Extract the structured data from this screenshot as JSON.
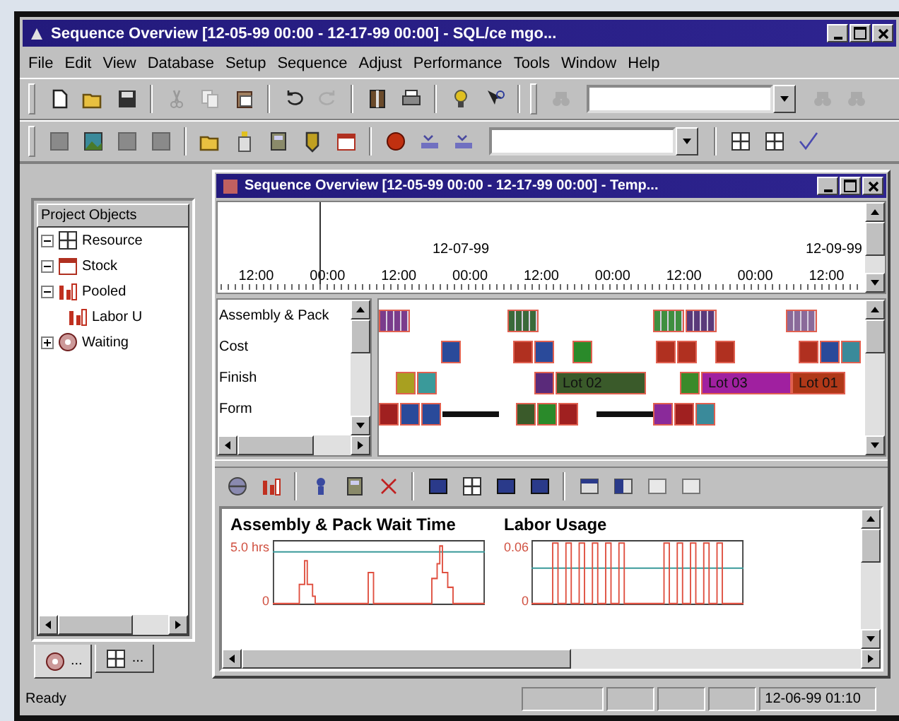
{
  "window": {
    "title": "Sequence Overview [12-05-99 00:00 - 12-17-99 00:00] - SQL/ce mgo..."
  },
  "menu": [
    "File",
    "Edit",
    "View",
    "Database",
    "Setup",
    "Sequence",
    "Adjust",
    "Performance",
    "Tools",
    "Window",
    "Help"
  ],
  "project_panel": {
    "title": "Project Objects",
    "tree": [
      {
        "label": "Resource",
        "expanded": true
      },
      {
        "label": "Stock",
        "expanded": true
      },
      {
        "label": "Pooled",
        "expanded": true,
        "children": [
          {
            "label": "Labor U"
          }
        ]
      },
      {
        "label": "Waiting",
        "expanded": false
      }
    ],
    "tabs": [
      {
        "label": "...",
        "selected": true
      },
      {
        "label": "...",
        "selected": false
      }
    ]
  },
  "sequence_window": {
    "title": "Sequence Overview [12-05-99 00:00 - 12-17-99 00:00] - Temp...",
    "timeline": {
      "dates": [
        "12-07-99",
        "12-09-99"
      ],
      "times": [
        "12:00",
        "00:00",
        "12:00",
        "00:00",
        "12:00",
        "00:00",
        "12:00",
        "00:00",
        "12:00"
      ]
    },
    "gantt": {
      "rows": [
        {
          "label": "Assembly & Pack",
          "segments": [
            {
              "kind": "stack",
              "color": "#7a3c8c"
            },
            {
              "kind": "space"
            },
            {
              "kind": "gap"
            },
            {
              "kind": "gap"
            },
            {
              "kind": "stack",
              "color": "#3a6a3a"
            },
            {
              "kind": "space"
            },
            {
              "kind": "gap"
            },
            {
              "kind": "gap"
            },
            {
              "kind": "gap"
            },
            {
              "kind": "stack",
              "color": "#3f8f3f"
            },
            {
              "kind": "stack",
              "color": "#5a3a7a"
            },
            {
              "kind": "gap"
            },
            {
              "kind": "gap"
            },
            {
              "kind": "gap"
            },
            {
              "kind": "gap"
            },
            {
              "kind": "stack",
              "color": "#8a6a9a"
            }
          ]
        },
        {
          "label": "Cost",
          "segments": [
            {
              "kind": "space"
            },
            {
              "kind": "block",
              "color": "#2a4a9a"
            },
            {
              "kind": "gap"
            },
            {
              "kind": "gap"
            },
            {
              "kind": "gap"
            },
            {
              "kind": "block",
              "color": "#b03020"
            },
            {
              "kind": "block",
              "color": "#2a4a9a"
            },
            {
              "kind": "gap"
            },
            {
              "kind": "block",
              "color": "#2a8a2a"
            },
            {
              "kind": "space"
            },
            {
              "kind": "block",
              "color": "#b03020"
            },
            {
              "kind": "block",
              "color": "#b03020"
            },
            {
              "kind": "gap"
            },
            {
              "kind": "block",
              "color": "#b03020"
            },
            {
              "kind": "space"
            },
            {
              "kind": "block",
              "color": "#b03020"
            },
            {
              "kind": "block",
              "color": "#2a4a9a"
            },
            {
              "kind": "block",
              "color": "#3a8a9a"
            }
          ]
        },
        {
          "label": "Finish",
          "segments": [
            {
              "kind": "gap"
            },
            {
              "kind": "block",
              "color": "#a8a020"
            },
            {
              "kind": "block",
              "color": "#3a9a9a"
            },
            {
              "kind": "space"
            },
            {
              "kind": "gap"
            },
            {
              "kind": "gap"
            },
            {
              "kind": "block",
              "color": "#5a2a7a"
            },
            {
              "kind": "lot",
              "color": "#3a5a2a",
              "label": "Lot 02"
            },
            {
              "kind": "gap"
            },
            {
              "kind": "gap"
            },
            {
              "kind": "block",
              "color": "#3a8a2a"
            },
            {
              "kind": "lot",
              "color": "#a020a0",
              "label": "Lot 03"
            },
            {
              "kind": "lot_short",
              "color": "#b03818",
              "label": "Lot 01"
            }
          ]
        },
        {
          "label": "Form",
          "segments": [
            {
              "kind": "block",
              "color": "#a02020"
            },
            {
              "kind": "block",
              "color": "#2a4a9a"
            },
            {
              "kind": "block",
              "color": "#2a4a9a"
            },
            {
              "kind": "link"
            },
            {
              "kind": "gap"
            },
            {
              "kind": "block",
              "color": "#3a5a2a"
            },
            {
              "kind": "block",
              "color": "#2a8a2a"
            },
            {
              "kind": "block",
              "color": "#a02020"
            },
            {
              "kind": "gap"
            },
            {
              "kind": "link"
            },
            {
              "kind": "block",
              "color": "#8a2a9a"
            },
            {
              "kind": "block",
              "color": "#a02020"
            },
            {
              "kind": "block",
              "color": "#3a8a9a"
            }
          ]
        }
      ]
    },
    "charts": [
      {
        "kind": "wait",
        "title": "Assembly & Pack Wait Time",
        "y_labels": [
          "5.0 hrs",
          "0"
        ]
      },
      {
        "kind": "usage",
        "title": "Labor Usage",
        "y_labels": [
          "0.06",
          "0"
        ]
      }
    ]
  },
  "status_bar": {
    "message": "Ready",
    "datetime": "12-06-99 01:10"
  }
}
